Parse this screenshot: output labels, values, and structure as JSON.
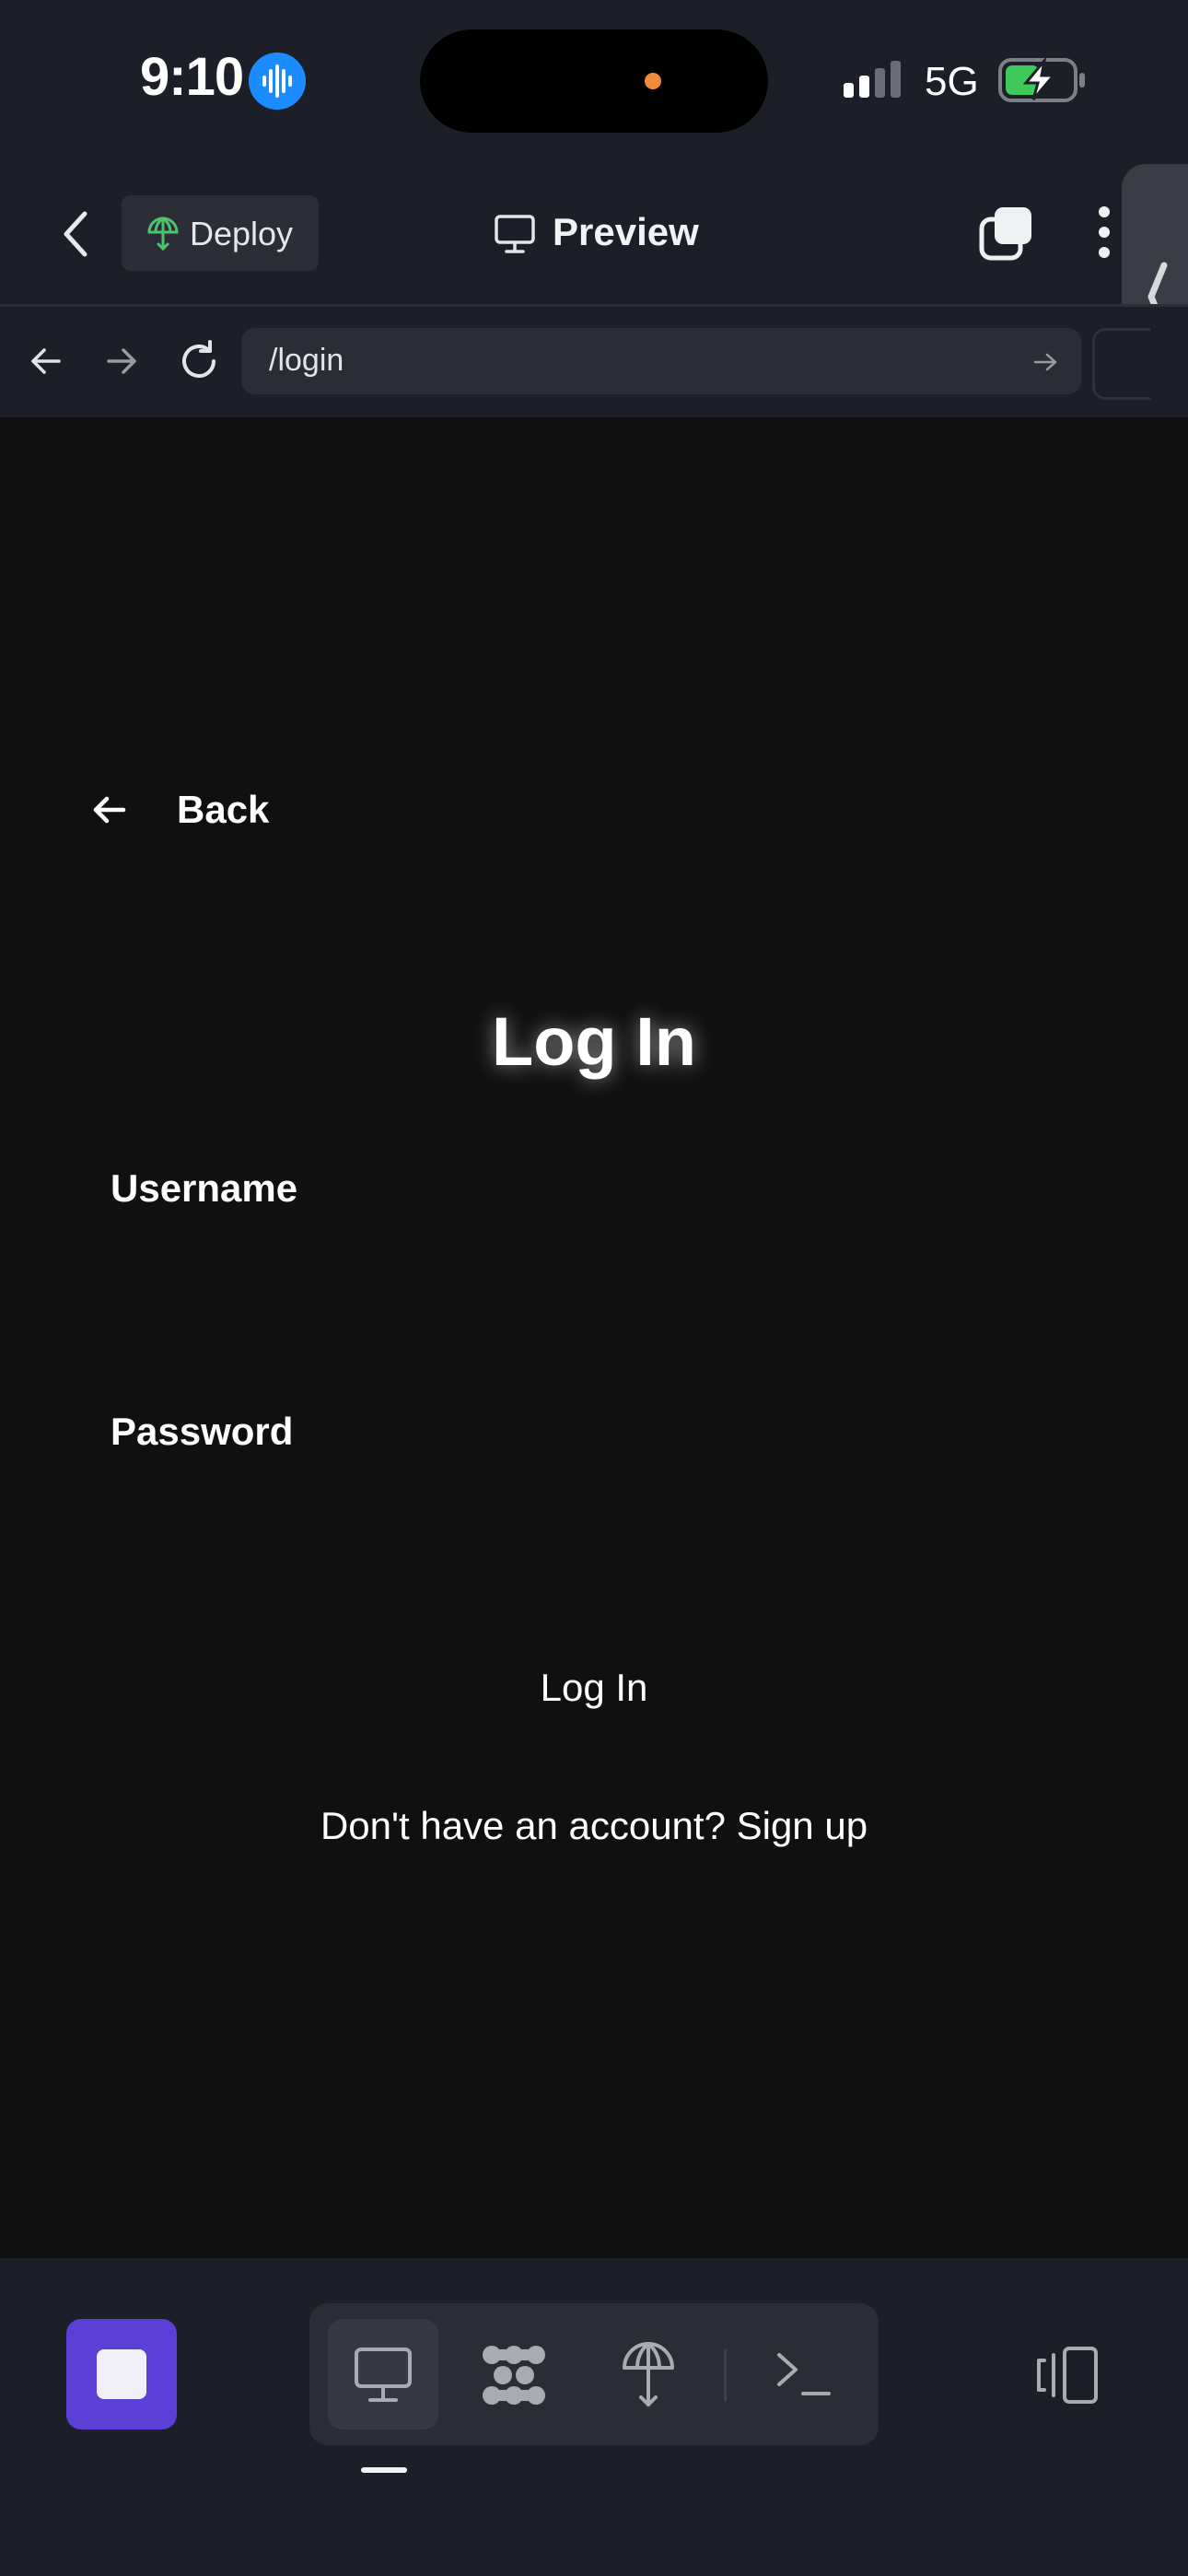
{
  "status_bar": {
    "time": "9:10",
    "network": "5G",
    "icons": [
      "voice-recording-icon",
      "signal-icon",
      "battery-charging-icon"
    ]
  },
  "topnav": {
    "deploy_label": "Deploy",
    "preview_label": "Preview",
    "icons": [
      "chevron-left-icon",
      "globe-icon",
      "monitor-icon",
      "tabs-icon",
      "more-vertical-icon",
      "collapse-panel-icon"
    ]
  },
  "urlbar": {
    "url": "/login",
    "icons": [
      "arrow-left-icon",
      "arrow-right-icon",
      "refresh-icon",
      "go-arrow-icon"
    ]
  },
  "page": {
    "back_label": "Back",
    "heading": "Log In",
    "username_label": "Username",
    "username_value": "",
    "password_label": "Password",
    "password_value": "",
    "login_button": "Log In",
    "signup_text": "Don't have an account? Sign up"
  },
  "bottombar": {
    "icons": [
      "stop-icon",
      "monitor-icon",
      "workspace-icon",
      "deploy-icon",
      "terminal-icon",
      "device-toggle-icon"
    ]
  },
  "colors": {
    "chrome_bg": "#1c1f27",
    "page_bg": "#101011",
    "accent": "#5b3fd6",
    "deploy_green": "#4fc36b",
    "link_blue": "#1a8cff"
  }
}
